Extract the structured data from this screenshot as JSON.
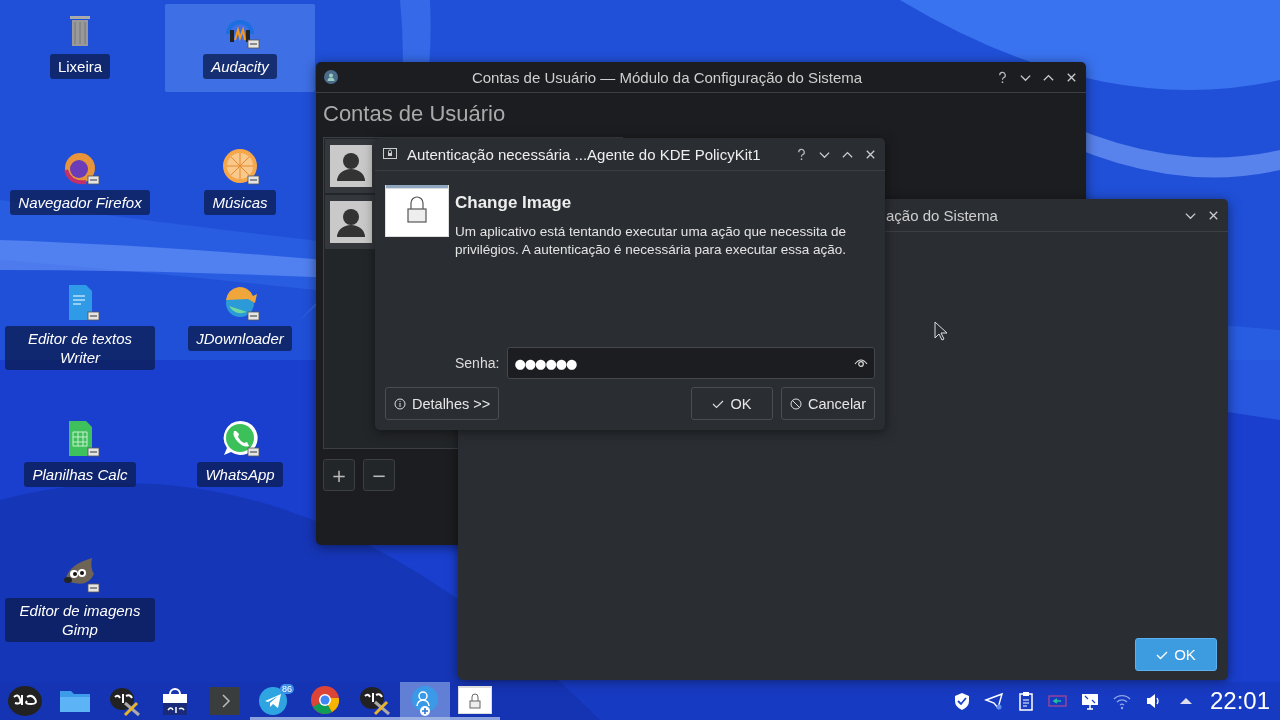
{
  "desktop_icons": [
    {
      "label": "Lixeira",
      "kind": "trash",
      "selected": false
    },
    {
      "label": "Audacity",
      "kind": "audio",
      "selected": true
    },
    {
      "label": "Navegador Firefox",
      "kind": "browser",
      "selected": false
    },
    {
      "label": "Músicas",
      "kind": "music",
      "selected": false
    },
    {
      "label": "Editor de textos Writer",
      "kind": "writer",
      "selected": false
    },
    {
      "label": "JDownloader",
      "kind": "download",
      "selected": false
    },
    {
      "label": "Planilhas Calc",
      "kind": "calc",
      "selected": false
    },
    {
      "label": "WhatsApp",
      "kind": "chat",
      "selected": false
    },
    {
      "label": "Editor de imagens Gimp",
      "kind": "gimp",
      "selected": false
    }
  ],
  "accounts_window": {
    "title": "Contas de Usuário — Módulo da Configuração do Sistema",
    "heading": "Contas de Usuário",
    "users": [
      {
        "kind": "avatar"
      },
      {
        "kind": "avatar"
      }
    ],
    "add_button": "+",
    "remove_button": "−"
  },
  "image_window": {
    "title": "ação do Sistema",
    "ok_button": "OK"
  },
  "auth_dialog": {
    "title": "Autenticação necessária ...Agente do KDE PolicyKit1",
    "heading": "Change Image",
    "message": "Um aplicativo está tentando executar uma ação que necessita de privilégios. A autenticação é necessária para executar essa ação.",
    "password_label": "Senha:",
    "password_value": "●●●●●●",
    "details_button": "Detalhes >>",
    "ok_button": "OK",
    "cancel_button": "Cancelar"
  },
  "taskbar": {
    "launchers": [
      {
        "kind": "logo",
        "running": false,
        "active": false
      },
      {
        "kind": "folder",
        "running": false,
        "active": false
      },
      {
        "kind": "tools",
        "running": false,
        "active": false
      },
      {
        "kind": "store",
        "running": false,
        "active": false
      },
      {
        "kind": "terminal",
        "running": false,
        "active": false
      },
      {
        "kind": "telegram",
        "running": true,
        "active": false,
        "badge": "86"
      },
      {
        "kind": "chrome",
        "running": true,
        "active": false
      },
      {
        "kind": "tools",
        "running": true,
        "active": false
      },
      {
        "kind": "users",
        "running": true,
        "active": true
      },
      {
        "kind": "lockwindow",
        "running": true,
        "active": false
      }
    ],
    "tray": [
      {
        "kind": "shield"
      },
      {
        "kind": "plane"
      },
      {
        "kind": "clipboard"
      },
      {
        "kind": "battery"
      },
      {
        "kind": "display"
      },
      {
        "kind": "wifi"
      },
      {
        "kind": "volume"
      },
      {
        "kind": "expand"
      }
    ],
    "clock": "22:01"
  }
}
